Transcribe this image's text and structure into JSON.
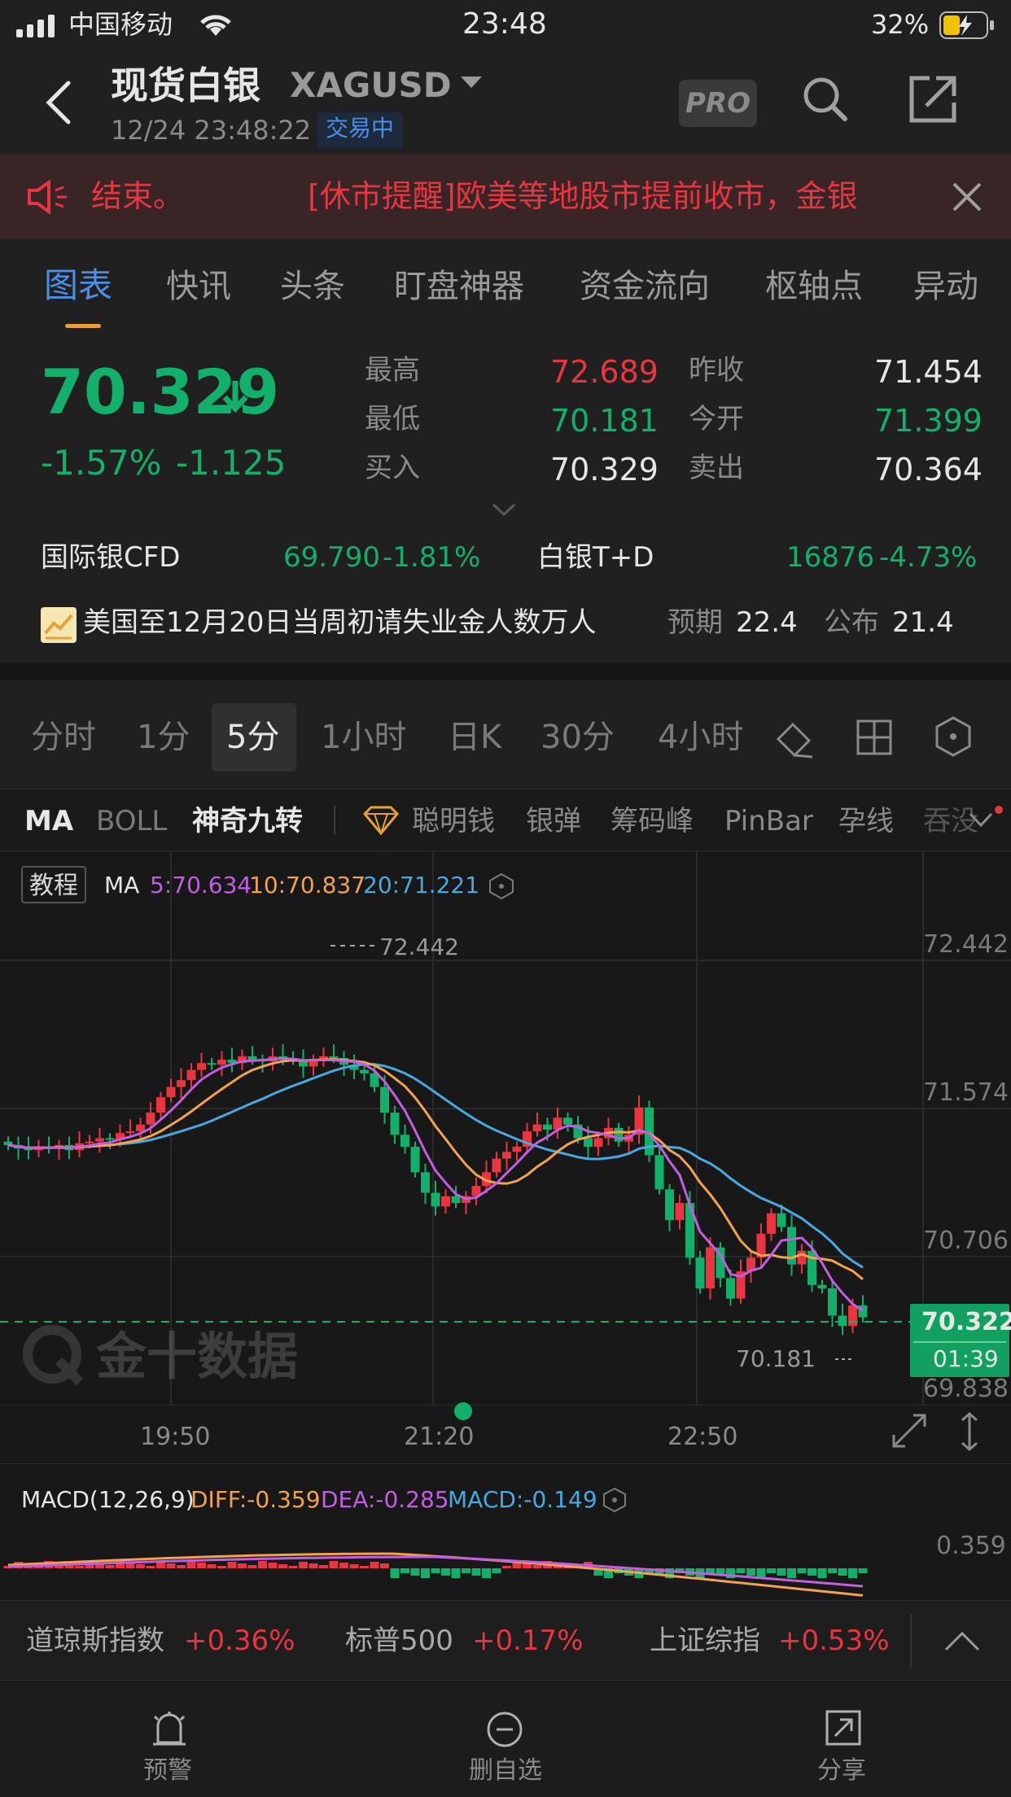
{
  "status_bar": {
    "carrier": "中国移动",
    "time": "23:48",
    "battery": "32%"
  },
  "header": {
    "title": "现货白银",
    "symbol": "XAGUSD",
    "datetime": "12/24 23:48:22",
    "market_status": "交易中",
    "pro_label": "PRO"
  },
  "notice": {
    "text_left": "结束。",
    "text_right": "[休市提醒]欧美等地股市提前收市，金银"
  },
  "tabs": [
    "图表",
    "快讯",
    "头条",
    "盯盘神器",
    "资金流向",
    "枢轴点",
    "异动"
  ],
  "quote": {
    "price": "70.329",
    "change_pct": "-1.57%",
    "change": "-1.125",
    "high_label": "最高",
    "high": "72.689",
    "low_label": "最低",
    "low": "70.181",
    "bid_label": "买入",
    "bid": "70.329",
    "prev_close_label": "昨收",
    "prev_close": "71.454",
    "open_label": "今开",
    "open": "71.399",
    "ask_label": "卖出",
    "ask": "70.364"
  },
  "related": [
    {
      "name": "国际银CFD",
      "price": "69.790",
      "change": "-1.81%"
    },
    {
      "name": "白银T+D",
      "price": "16876",
      "change": "-4.73%"
    }
  ],
  "event": {
    "title": "美国至12月20日当周初请失业金人数万人",
    "expected_label": "预期",
    "expected": "22.4",
    "actual_label": "公布",
    "actual": "21.4"
  },
  "periods": [
    "分时",
    "1分",
    "5分",
    "1小时",
    "日K",
    "30分",
    "4小时"
  ],
  "active_period": "5分",
  "indicators": [
    "MA",
    "BOLL",
    "神奇九转",
    "聪明钱",
    "银弹",
    "筹码峰",
    "PinBar",
    "孕线",
    "吞没"
  ],
  "chart": {
    "tutorial_label": "教程",
    "ma_label": "MA",
    "ma5": "5:70.634",
    "ma10": "10:70.837",
    "ma20": "20:71.221",
    "y_ticks": [
      "72.442",
      "71.574",
      "70.706",
      "69.838"
    ],
    "high_marker": "72.442",
    "low_marker": "70.181",
    "current_price": "70.322",
    "countdown": "01:39",
    "watermark": "金十数据",
    "x_ticks": [
      "19:50",
      "21:20",
      "22:50"
    ],
    "colors": {
      "ma5": "#c25ee0",
      "ma10": "#f2a250",
      "ma20": "#4aa8e0",
      "up": "#e8353f",
      "down": "#12b06a"
    }
  },
  "chart_data": {
    "type": "candlestick",
    "title": "",
    "xlabel": "",
    "ylabel": "",
    "ylim": [
      69.838,
      72.6
    ],
    "x_ticks": [
      "19:50",
      "21:20",
      "22:50"
    ],
    "series": [
      {
        "name": "MA5",
        "value": 70.634
      },
      {
        "name": "MA10",
        "value": 70.837
      },
      {
        "name": "MA20",
        "value": 71.221
      }
    ],
    "high": 72.442,
    "low": 70.181,
    "last": 70.322
  },
  "macd": {
    "label": "MACD(12,26,9)",
    "diff": "DIFF:-0.359",
    "dea": "DEA:-0.285",
    "macd": "MACD:-0.149",
    "y_tick": "0.359"
  },
  "indices": [
    {
      "name": "道琼斯指数",
      "change": "+0.36%"
    },
    {
      "name": "标普500",
      "change": "+0.17%"
    },
    {
      "name": "上证综指",
      "change": "+0.53%"
    }
  ],
  "bottom_nav": [
    {
      "label": "预警",
      "icon": "alarm-icon"
    },
    {
      "label": "删自选",
      "icon": "minus-circle-icon"
    },
    {
      "label": "分享",
      "icon": "share-icon"
    }
  ]
}
